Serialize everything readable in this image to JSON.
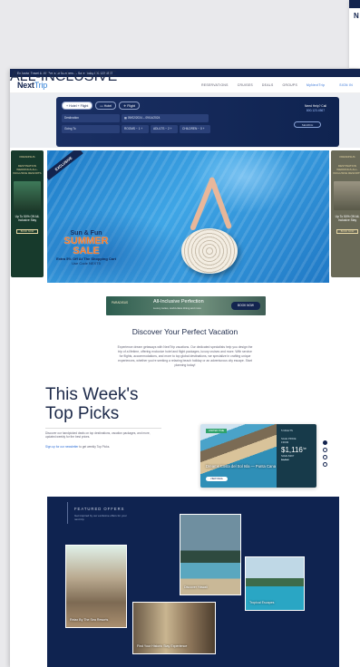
{
  "bg_card": {
    "letter": "N"
  },
  "topbar": {
    "text": "Exclusive Travel & VIP Perks for Members — Save Today   800.123.4567"
  },
  "nav": {
    "logo_main": "Next",
    "logo_accent": "Trip",
    "items": [
      "RESERVATIONS",
      "CRUISES",
      "DEALS",
      "GROUPS"
    ],
    "account": "MyNextTrip",
    "signin": "SIGN IN"
  },
  "search": {
    "tabs": [
      "Hotel + Flight",
      "Hotel",
      "Flight"
    ],
    "from_label": "Destination",
    "dates": "09/02/2024 – 09/14/2024",
    "to_label": "Going To",
    "rooms_label": "ROOMS",
    "rooms_value": "1",
    "adults_label": "ADULTS",
    "adults_value": "2",
    "children_label": "CHILDREN",
    "children_value": "0",
    "agent_label": "Need Help? Call",
    "agent_phone": "800.123.4567",
    "search_button": "SEARCH"
  },
  "hero": {
    "ribbon": "EXCLUSIVE",
    "kicker": "Sun & Fun",
    "title": "SUMMER SALE",
    "line1": "Extra 5% Off At The Shopping Cart",
    "line2": "Use Code NEXT5"
  },
  "side_ads": {
    "left": {
      "brand": "PARADISUS",
      "title": "DESTINATION WEDDINGS ALL-INCLUSIVE RESORTS",
      "promo": "Up To 50% Off All-Inclusive Stay",
      "button": "BOOK NOW"
    },
    "right": {
      "brand": "PARADISUS",
      "title": "DESTINATION WEDDINGS ALL-INCLUSIVE RESORTS",
      "promo": "Up To 50% Off All-Inclusive Stay",
      "button": "BOOK NOW"
    }
  },
  "banner": {
    "brand": "PARADISUS",
    "title": "All-Inclusive Perfection",
    "subtitle": "Luxury suites, world-class dining and more",
    "button": "BOOK NOW"
  },
  "discover": {
    "title": "Discover Your Perfect Vacation",
    "text": "Experience dream getaways with NextTrip vacations. Our dedicated specialists help you design the trip of a lifetime, offering exclusive hotel and flight packages, luxury cruises and more. With service for flights, accommodations, and more to top global destinations, we specialize in crafting unique experiences, whether you're seeking a relaxing beach holiday or an adventurous city escape. Start planning today!"
  },
  "picks": {
    "title_line1": "This Week's",
    "title_line2": "Top Picks",
    "description": "Discover our handpicked deals on top destinations, vacation packages, and more, updated weekly for the best prices.",
    "link_prefix": "Sign up for our newsletter",
    "link_suffix": "to get weekly Top Picks."
  },
  "deal_card": {
    "tag": "LIMITED TIME",
    "title": "Dreams Costa del Sol Isla — Punta Cana",
    "cta": "VIEW DEAL",
    "vertical": "ALL-INCLUSIVE",
    "nights": "5 NIGHTS",
    "sale_label": "SALE PRICE",
    "from": "FROM",
    "price": "$1,116",
    "per": "/pp",
    "save": "SAVE $397",
    "old": "$1,513"
  },
  "carousel": {
    "count": 4,
    "active": 0
  },
  "featured": {
    "label": "FEATURED OFFERS",
    "subtitle": "Get inspired by our exclusive offers for your next trip",
    "tiles": [
      "Relax By The Sea Resorts",
      "Discover Hawaii",
      "Tropical Escapes",
      "Find Your Historic Stay Experience"
    ]
  }
}
